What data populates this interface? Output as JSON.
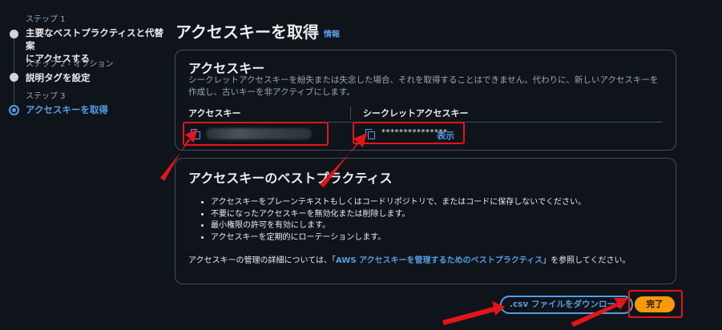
{
  "steps": [
    {
      "num": "ステップ 1",
      "title_line1": "主要なベストプラクティスと代替案",
      "title_line2": "にアクセスする",
      "state": "done"
    },
    {
      "num": "ステップ 2 - オプション",
      "title_line1": "説明タグを設定",
      "title_line2": "",
      "state": "done"
    },
    {
      "num": "ステップ 3",
      "title_line1": "アクセスキーを取得",
      "title_line2": "",
      "state": "current"
    }
  ],
  "header": {
    "title": "アクセスキーを取得",
    "info_link": "情報"
  },
  "access_key_panel": {
    "heading": "アクセスキー",
    "description": "シークレットアクセスキーを紛失または失念した場合、それを取得することはできません。代わりに、新しいアクセスキーを作成し、古いキーを非アクティブにします。",
    "columns": {
      "access_key": "アクセスキー",
      "secret_key": "シークレットアクセスキー"
    },
    "secret_masked": "***************",
    "show_label": "表示"
  },
  "best_practices": {
    "heading": "アクセスキーのベストプラクティス",
    "items": [
      "アクセスキーをプレーンテキストもしくはコードリポジトリで、またはコードに保存しないでください。",
      "不要になったアクセスキーを無効化または削除します。",
      "最小権限の許可を有効にします。",
      "アクセスキーを定期的にローテーションします。"
    ],
    "footer_prefix": "アクセスキーの管理の詳細については、「",
    "footer_link": "AWS アクセスキーを管理するためのベストプラクティス",
    "footer_suffix": "」を参照してください。"
  },
  "actions": {
    "download_csv": ".csv ファイルをダウンロード",
    "done": "完了"
  },
  "colors": {
    "accent": "#539fe5",
    "primary_button": "#ff9900",
    "annotation": "#e3151a",
    "background": "#0f141a"
  }
}
